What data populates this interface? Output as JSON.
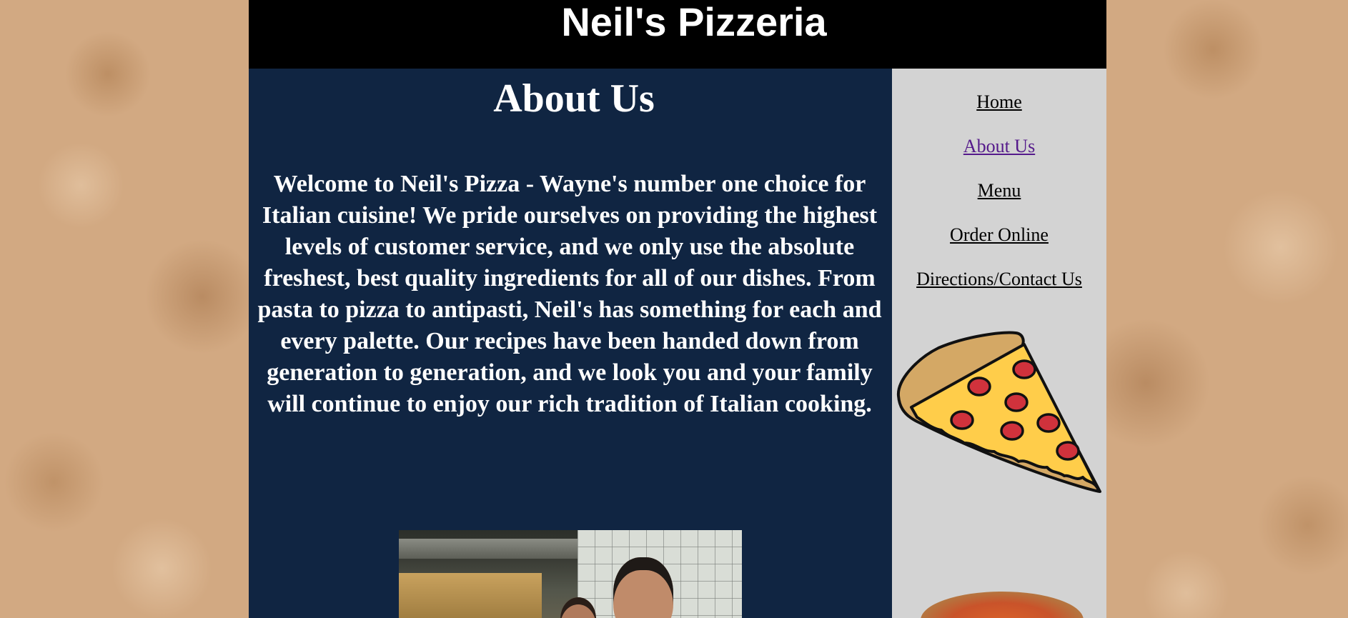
{
  "header": {
    "site_title": "Neil's Pizzeria"
  },
  "main": {
    "heading": "About Us",
    "intro": "Welcome to Neil's Pizza - Wayne's number one choice for Italian cuisine! We pride ourselves on providing the highest levels of customer service, and we only use the absolute freshest, best quality ingredients for all of our dishes. From pasta to pizza to antipasti, Neil's has something for each and every palette. Our recipes have been handed down from generation to generation, and we look you and your family will continue to enjoy our rich tradition of Italian cooking."
  },
  "nav": {
    "items": [
      {
        "label": "Home",
        "visited": false
      },
      {
        "label": "About Us",
        "visited": true
      },
      {
        "label": "Menu",
        "visited": false
      },
      {
        "label": "Order Online",
        "visited": false
      },
      {
        "label": "Directions/Contact Us",
        "visited": false
      }
    ]
  },
  "images": {
    "slice": "pizza-slice-icon",
    "whole": "whole-pizza-photo",
    "staff": "staff-photo"
  },
  "colors": {
    "header_bg": "#000000",
    "content_bg": "#102542",
    "sidebar_bg": "#d3d3d3",
    "visited_link": "#551a8b",
    "cheese": "#ffcd4a",
    "pepperoni": "#d0323c",
    "crust": "#d4a865"
  }
}
